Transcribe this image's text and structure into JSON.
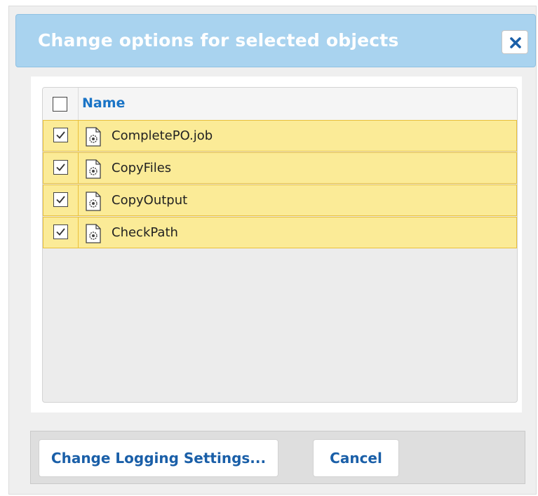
{
  "dialog": {
    "title": "Change options for selected objects",
    "close_icon": "close-icon",
    "accent_color": "#a9d3ef",
    "selected_row_color": "#fbeb97"
  },
  "grid": {
    "header": {
      "name_label": "Name",
      "select_all_checked": false
    },
    "rows": [
      {
        "label": "CompletePO.job",
        "checked": true,
        "icon": "job-file-icon"
      },
      {
        "label": "CopyFiles",
        "checked": true,
        "icon": "job-file-icon"
      },
      {
        "label": "CopyOutput",
        "checked": true,
        "icon": "job-file-icon"
      },
      {
        "label": "CheckPath",
        "checked": true,
        "icon": "job-file-icon"
      }
    ]
  },
  "footer": {
    "change_logging_label": "Change Logging Settings...",
    "cancel_label": "Cancel"
  }
}
